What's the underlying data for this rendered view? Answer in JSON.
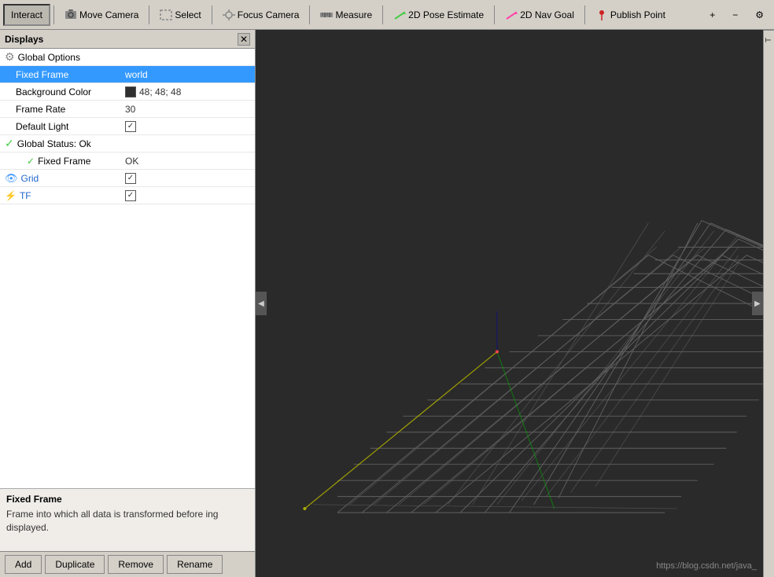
{
  "toolbar": {
    "title": "RViz",
    "buttons": [
      {
        "id": "interact",
        "label": "Interact",
        "active": true,
        "icon": "cursor"
      },
      {
        "id": "move-camera",
        "label": "Move Camera",
        "active": false,
        "icon": "camera"
      },
      {
        "id": "select",
        "label": "Select",
        "active": false,
        "icon": "select"
      },
      {
        "id": "focus-camera",
        "label": "Focus Camera",
        "active": false,
        "icon": "focus"
      },
      {
        "id": "measure",
        "label": "Measure",
        "active": false,
        "icon": "ruler"
      },
      {
        "id": "2d-pose",
        "label": "2D Pose Estimate",
        "active": false,
        "icon": "pose"
      },
      {
        "id": "2d-nav",
        "label": "2D Nav Goal",
        "active": false,
        "icon": "nav"
      },
      {
        "id": "publish-point",
        "label": "Publish Point",
        "active": false,
        "icon": "point"
      }
    ],
    "plus_label": "+",
    "minus_label": "−",
    "settings_label": "⚙"
  },
  "left_panel": {
    "title": "Displays",
    "close_label": "✕",
    "rows": [
      {
        "id": "global-options",
        "name": "Global Options",
        "value": "",
        "indent": 0,
        "icon": "gear",
        "selected": false
      },
      {
        "id": "fixed-frame",
        "name": "Fixed Frame",
        "value": "world",
        "indent": 1,
        "icon": "",
        "selected": true
      },
      {
        "id": "bg-color",
        "name": "Background Color",
        "value": "48; 48; 48",
        "indent": 1,
        "icon": "",
        "selected": false,
        "swatch": "#303030"
      },
      {
        "id": "frame-rate",
        "name": "Frame Rate",
        "value": "30",
        "indent": 1,
        "icon": "",
        "selected": false
      },
      {
        "id": "default-light",
        "name": "Default Light",
        "value": "checked",
        "indent": 1,
        "icon": "",
        "selected": false
      },
      {
        "id": "global-status",
        "name": "Global Status: Ok",
        "value": "",
        "indent": 0,
        "icon": "checkmark-green",
        "selected": false
      },
      {
        "id": "fixed-frame-status",
        "name": "Fixed Frame",
        "value": "OK",
        "indent": 1,
        "icon": "checkmark-green",
        "selected": false
      },
      {
        "id": "grid",
        "name": "Grid",
        "value": "checked",
        "indent": 0,
        "icon": "eye-blue",
        "selected": false
      },
      {
        "id": "tf",
        "name": "TF",
        "value": "checked",
        "indent": 0,
        "icon": "tf-blue",
        "selected": false
      }
    ]
  },
  "info_box": {
    "title": "ixed Frame",
    "text": "ame into which all data is transformed before\ning displayed."
  },
  "bottom_buttons": [
    {
      "id": "add",
      "label": "Add"
    },
    {
      "id": "duplicate",
      "label": "Duplicate"
    },
    {
      "id": "remove",
      "label": "Remove"
    },
    {
      "id": "rename",
      "label": "Rename"
    }
  ],
  "viewport": {
    "url": "https://blog.csdn.net/java_"
  },
  "right_panel": {
    "label": "T"
  }
}
